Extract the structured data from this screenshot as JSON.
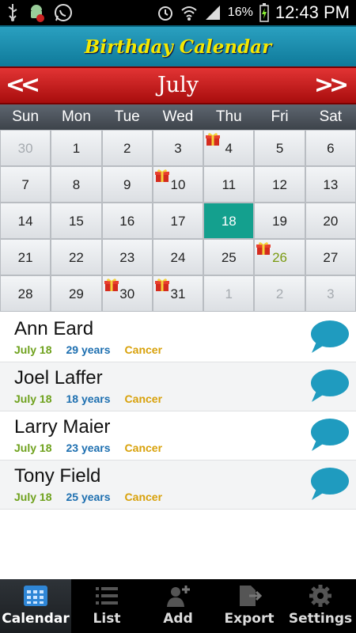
{
  "status_bar": {
    "battery": "16%",
    "time": "12:43 PM"
  },
  "header": {
    "title": "Birthday Calendar"
  },
  "month_nav": {
    "month": "July",
    "prev_label": "<<",
    "next_label": ">>"
  },
  "weekdays": [
    "Sun",
    "Mon",
    "Tue",
    "Wed",
    "Thu",
    "Fri",
    "Sat"
  ],
  "calendar": {
    "rows": [
      [
        {
          "d": "30",
          "muted": true
        },
        {
          "d": "1"
        },
        {
          "d": "2"
        },
        {
          "d": "3"
        },
        {
          "d": "4",
          "gift": true
        },
        {
          "d": "5"
        },
        {
          "d": "6"
        }
      ],
      [
        {
          "d": "7"
        },
        {
          "d": "8"
        },
        {
          "d": "9"
        },
        {
          "d": "10",
          "gift": true
        },
        {
          "d": "11"
        },
        {
          "d": "12"
        },
        {
          "d": "13"
        }
      ],
      [
        {
          "d": "14"
        },
        {
          "d": "15"
        },
        {
          "d": "16"
        },
        {
          "d": "17"
        },
        {
          "d": "18",
          "today": true
        },
        {
          "d": "19"
        },
        {
          "d": "20"
        }
      ],
      [
        {
          "d": "21"
        },
        {
          "d": "22"
        },
        {
          "d": "23"
        },
        {
          "d": "24"
        },
        {
          "d": "25"
        },
        {
          "d": "26",
          "gift": true,
          "green": true
        },
        {
          "d": "27"
        }
      ],
      [
        {
          "d": "28"
        },
        {
          "d": "29"
        },
        {
          "d": "30",
          "gift": true
        },
        {
          "d": "31",
          "gift": true
        },
        {
          "d": "1",
          "muted": true
        },
        {
          "d": "2",
          "muted": true
        },
        {
          "d": "3",
          "muted": true
        }
      ]
    ]
  },
  "birthdays": [
    {
      "name": "Ann Eard",
      "date": "July 18",
      "age": "29 years",
      "sign": "Cancer"
    },
    {
      "name": "Joel Laffer",
      "date": "July 18",
      "age": "18 years",
      "sign": "Cancer"
    },
    {
      "name": "Larry Maier",
      "date": "July 18",
      "age": "23 years",
      "sign": "Cancer"
    },
    {
      "name": "Tony Field",
      "date": "July 18",
      "age": "25 years",
      "sign": "Cancer"
    }
  ],
  "tabs": [
    {
      "label": "Calendar",
      "icon": "calendar-grid-icon",
      "active": true
    },
    {
      "label": "List",
      "icon": "list-icon"
    },
    {
      "label": "Add",
      "icon": "add-person-icon"
    },
    {
      "label": "Export",
      "icon": "export-icon"
    },
    {
      "label": "Settings",
      "icon": "gear-icon"
    }
  ],
  "colors": {
    "title_bar": "#1a8fb0",
    "title_text": "#f4e800",
    "month_bar": "#c81e1e",
    "today_cell": "#14a08e",
    "date_text": "#6ea11c",
    "age_text": "#1d6fb0",
    "sign_text": "#d8a10a",
    "bubble": "#1f9bbf"
  }
}
